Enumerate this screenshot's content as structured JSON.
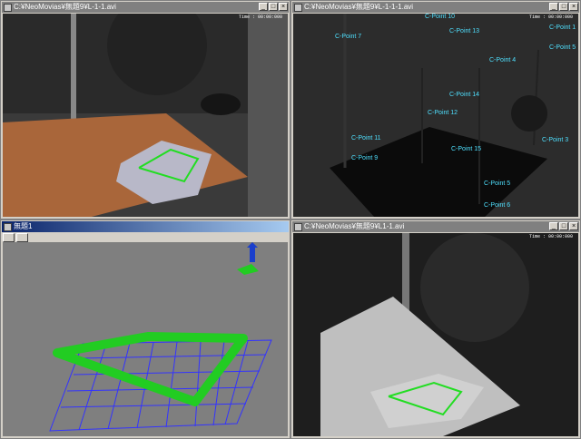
{
  "windows": {
    "top_left": {
      "title": "C:¥NeoMovias¥無題9¥L-1-1.avi",
      "time": "Time : 00:00:000"
    },
    "top_right": {
      "title": "C:¥NeoMovias¥無題9¥L-1-1-1.avi",
      "time": "Time : 00:00:000"
    },
    "bottom_left": {
      "title": "無題1"
    },
    "bottom_right": {
      "title": "C:¥NeoMovias¥無題9¥L1-1.avi",
      "time": "Time : 00:00:000"
    }
  },
  "points": [
    {
      "label": "C-Point 10"
    },
    {
      "label": "C-Point 13"
    },
    {
      "label": "C-Point 7"
    },
    {
      "label": "C-Point 1"
    },
    {
      "label": "C-Point 5"
    },
    {
      "label": "C-Point 4"
    },
    {
      "label": "C-Point 14"
    },
    {
      "label": "C-Point 12"
    },
    {
      "label": "C-Point 11"
    },
    {
      "label": "C-Point 9"
    },
    {
      "label": "C-Point 15"
    },
    {
      "label": "C-Point 3"
    },
    {
      "label": "C-Point 5"
    },
    {
      "label": "C-Point 6"
    }
  ],
  "icons": {
    "close": "close-icon",
    "minimize": "minimize-icon",
    "maximize": "maximize-icon",
    "window": "window-icon",
    "axis": "axis-gizmo-icon"
  },
  "colors": {
    "active_title": "#0a246a",
    "inactive_title": "#808080",
    "marker": "#4fe0ff",
    "box_green": "#22cc22",
    "grid_blue": "#3333ff"
  }
}
